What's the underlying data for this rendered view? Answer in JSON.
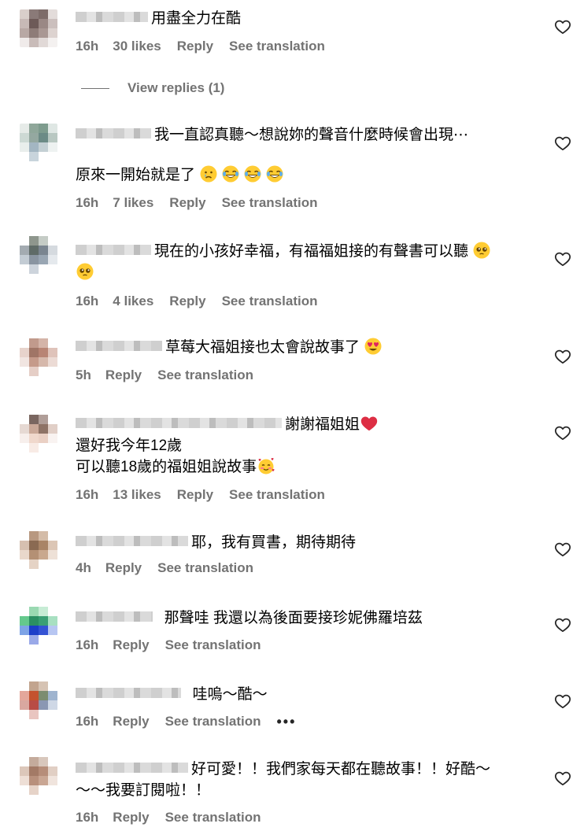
{
  "heart_icon": "heart-outline-icon",
  "colors": {
    "meta": "#737373",
    "text": "#000000",
    "heart": "#262626"
  },
  "comments": [
    {
      "lines": [
        "用盡全力在酷"
      ],
      "time": "16h",
      "likes": "30 likes",
      "reply": "Reply",
      "translate": "See translation",
      "view_replies": "View replies (1)"
    },
    {
      "lines": [
        "我一直認真聽～想說妳的聲音什麼時候會出現⋯",
        "原來一開始就是了"
      ],
      "time": "16h",
      "likes": "7 likes",
      "reply": "Reply",
      "translate": "See translation"
    },
    {
      "lines": [
        "現在的小孩好幸福，有福福姐接的有聲書可以聽"
      ],
      "time": "16h",
      "likes": "4 likes",
      "reply": "Reply",
      "translate": "See translation"
    },
    {
      "lines": [
        "草莓大福姐接也太會說故事了"
      ],
      "time": "5h",
      "reply": "Reply",
      "translate": "See translation"
    },
    {
      "lines": [
        "謝謝福姐姐",
        "還好我今年12歲",
        "可以聽18歲的福姐姐說故事"
      ],
      "time": "16h",
      "likes": "13 likes",
      "reply": "Reply",
      "translate": "See translation"
    },
    {
      "lines": [
        "耶，我有買書，期待期待"
      ],
      "time": "4h",
      "reply": "Reply",
      "translate": "See translation"
    },
    {
      "lines": [
        "那聲哇 我還以為後面要接珍妮佛羅培茲"
      ],
      "time": "16h",
      "reply": "Reply",
      "translate": "See translation"
    },
    {
      "lines": [
        "哇嗚～酷～"
      ],
      "time": "16h",
      "reply": "Reply",
      "translate": "See translation",
      "more": "•••"
    },
    {
      "lines": [
        "好可愛！！我們家每天都在聽故事！！好酷～",
        "～～我要訂閱啦！！"
      ],
      "time": "16h",
      "reply": "Reply",
      "translate": "See translation"
    }
  ]
}
